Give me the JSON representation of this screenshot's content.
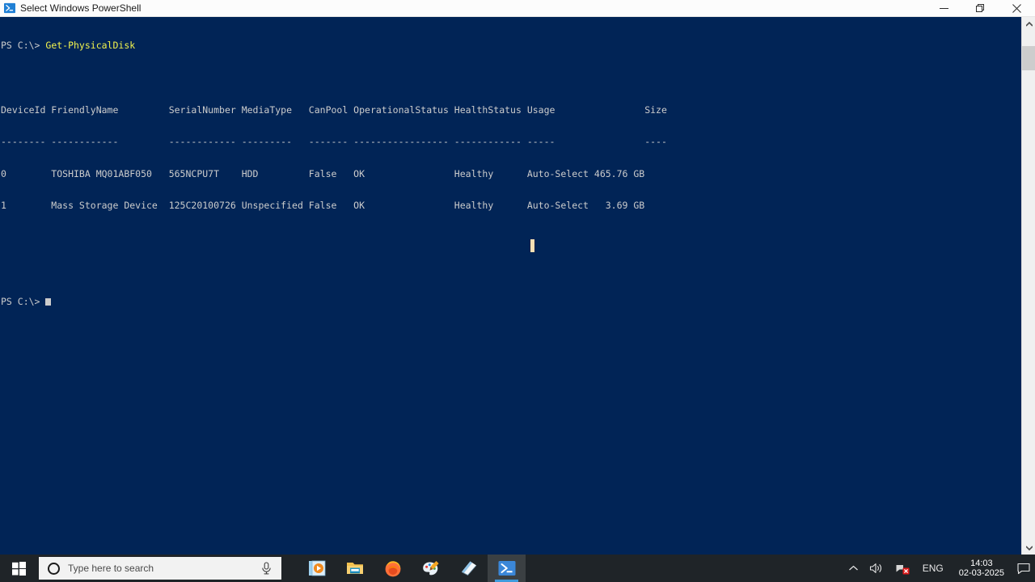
{
  "window": {
    "title": "Select Windows PowerShell",
    "icon": "powershell-icon",
    "minimize_label": "–",
    "maximize_label": "❐",
    "close_label": "✕"
  },
  "console": {
    "background_color": "#012456",
    "text_color": "#cccccc",
    "command_color": "#f3f34d",
    "prompt": "PS C:\\> ",
    "command": "Get-PhysicalDisk",
    "final_prompt": "PS C:\\> ",
    "header": "DeviceId FriendlyName         SerialNumber MediaType   CanPool OperationalStatus HealthStatus Usage                Size",
    "separator": "-------- ------------         ------------ ---------   ------- ----------------- ------------ -----                ----",
    "row1": "0        TOSHIBA MQ01ABF050   565NCPU7T    HDD         False   OK                Healthy      Auto-Select 465.76 GB",
    "row2": "1        Mass Storage Device  125C20100726 Unspecified False   OK                Healthy      Auto-Select   3.69 GB",
    "table": {
      "columns": [
        "DeviceId",
        "FriendlyName",
        "SerialNumber",
        "MediaType",
        "CanPool",
        "OperationalStatus",
        "HealthStatus",
        "Usage",
        "Size"
      ],
      "rows": [
        [
          "0",
          "TOSHIBA MQ01ABF050",
          "565NCPU7T",
          "HDD",
          "False",
          "OK",
          "Healthy",
          "Auto-Select",
          "465.76 GB"
        ],
        [
          "1",
          "Mass Storage Device",
          "125C20100726",
          "Unspecified",
          "False",
          "OK",
          "Healthy",
          "Auto-Select",
          "3.69 GB"
        ]
      ]
    }
  },
  "scrollbar": {
    "up_arrow": "▲",
    "down_arrow": "▼"
  },
  "taskbar": {
    "start_label": "Start",
    "search": {
      "placeholder": "Type here to search",
      "icon": "search-circle-icon",
      "mic_icon": "microphone-icon"
    },
    "apps": [
      {
        "name": "media-player",
        "running": false
      },
      {
        "name": "file-explorer",
        "running": true
      },
      {
        "name": "firefox",
        "running": true
      },
      {
        "name": "paint",
        "running": true
      },
      {
        "name": "sticky-notes",
        "running": true
      },
      {
        "name": "windows-powershell",
        "running": true,
        "active": true
      }
    ],
    "tray": {
      "chevron": "∧",
      "volume_icon": "speaker-icon",
      "network_icon": "network-disconnected-icon",
      "language": "ENG",
      "time": "14:03",
      "date": "02-03-2025",
      "notification_icon": "action-center-icon"
    }
  }
}
